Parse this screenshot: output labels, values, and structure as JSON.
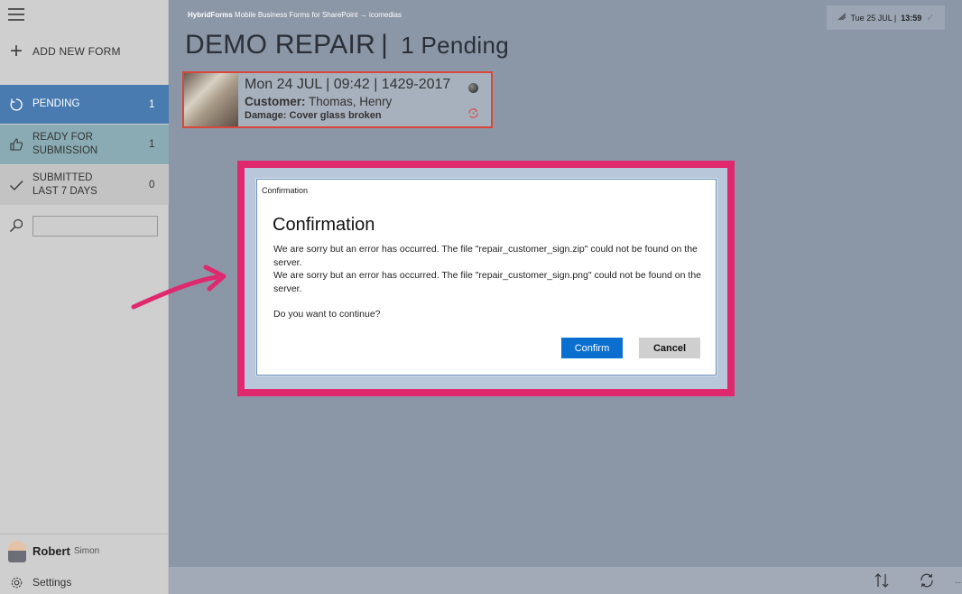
{
  "sidebar": {
    "add_form_label": "ADD NEW FORM",
    "items": [
      {
        "label_line1": "PENDING",
        "label_line2": "",
        "count": "1"
      },
      {
        "label_line1": "READY FOR",
        "label_line2": "SUBMISSION",
        "count": "1"
      },
      {
        "label_line1": "SUBMITTED",
        "label_line2": "LAST 7 DAYS",
        "count": "0"
      }
    ],
    "search_value": "",
    "user": {
      "first_name": "Robert",
      "last_name": "Simon"
    },
    "settings_label": "Settings"
  },
  "header": {
    "brand": "HybridForms",
    "breadcrumb": "Mobile Business Forms for SharePoint → icomedias",
    "date_prefix": "Tue 25 JUL |",
    "time": "13:59",
    "title": "DEMO REPAIR",
    "separator": "|",
    "pending_label": "1 Pending"
  },
  "form_card": {
    "line1": "Mon 24 JUL | 09:42 | 1429-2017",
    "customer_label": "Customer:",
    "customer_value": "Thomas, Henry",
    "damage_label": "Damage:",
    "damage_value": "Cover glass broken"
  },
  "dialog": {
    "caption": "Confirmation",
    "title": "Confirmation",
    "message1": "We are sorry but an error has occurred. The file \"repair_customer_sign.zip\" could not be found on the server.",
    "message2": "We are sorry but an error has occurred. The file \"repair_customer_sign.png\" could not be found on the server.",
    "question": "Do you want to continue?",
    "confirm_label": "Confirm",
    "cancel_label": "Cancel"
  },
  "colors": {
    "highlight": "#e0286e",
    "accent_blue": "#0a6fcf",
    "pending_bg": "#4a7bb0",
    "error_border": "#d8473c"
  },
  "icons": [
    "hamburger-icon",
    "plus-icon",
    "refresh-icon",
    "thumbs-up-icon",
    "checkmark-icon",
    "search-icon",
    "gear-icon",
    "sort-icon",
    "sync-icon",
    "status-dot-icon",
    "network-icon"
  ]
}
